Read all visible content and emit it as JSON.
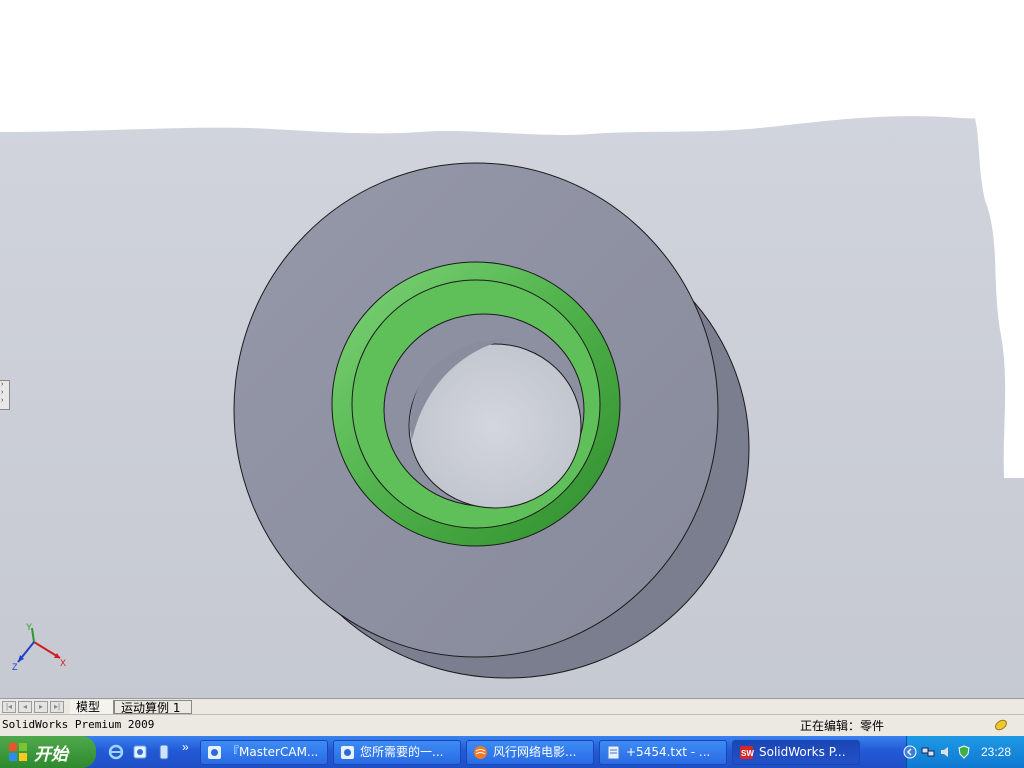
{
  "viewport": {
    "background": "#c9cdd6",
    "part_color": "#8f92a3",
    "face_color": "#3fae3a"
  },
  "triad": {
    "x_label": "X",
    "y_label": "Y",
    "z_label": "Z"
  },
  "bottom_tabs": {
    "model": "模型",
    "motion_study": "运动算例 1"
  },
  "status": {
    "app_name": "SolidWorks Premium 2009",
    "editing": "正在编辑：零件"
  },
  "taskbar": {
    "start_label": "开始",
    "more": "»",
    "tasks": [
      {
        "label": "『MasterCAM...",
        "icon": "ie-icon"
      },
      {
        "label": "您所需要的一...",
        "icon": "ie-icon"
      },
      {
        "label": "风行网络电影...",
        "icon": "media-icon"
      },
      {
        "label": "+5454.txt - ...",
        "icon": "notepad-icon"
      },
      {
        "label": "SolidWorks P...",
        "icon": "solidworks-icon"
      }
    ],
    "clock": "23:28"
  }
}
